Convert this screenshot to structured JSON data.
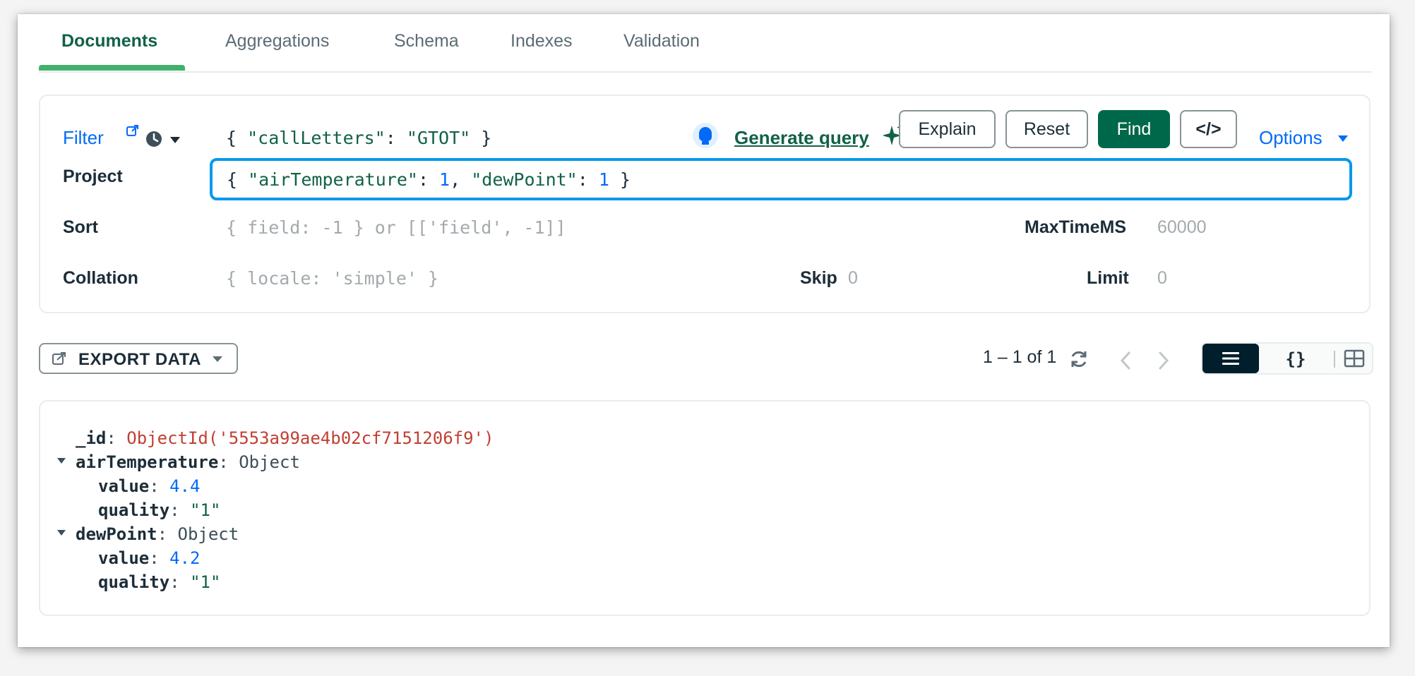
{
  "tabs": [
    {
      "label": "Documents",
      "active": true
    },
    {
      "label": "Aggregations"
    },
    {
      "label": "Schema"
    },
    {
      "label": "Indexes"
    },
    {
      "label": "Validation"
    }
  ],
  "query": {
    "filter_label": "Filter",
    "filter_open": "{ ",
    "filter_key": "\"callLetters\"",
    "filter_colon": ": ",
    "filter_value": "\"GTOT\"",
    "filter_close": " }",
    "generate_query_label": "Generate query",
    "explain_label": "Explain",
    "reset_label": "Reset",
    "find_label": "Find",
    "code_label": "</>",
    "options_label": "Options",
    "project_label": "Project",
    "project_parts": {
      "open": "{ ",
      "k1": "\"airTemperature\"",
      "c1": ": ",
      "v1": "1",
      "sep": ", ",
      "k2": "\"dewPoint\"",
      "c2": ": ",
      "v2": "1",
      "close": " }"
    },
    "sort_label": "Sort",
    "sort_placeholder": "{ field: -1 } or [['field', -1]]",
    "maxtime_label": "MaxTimeMS",
    "maxtime_placeholder": "60000",
    "collation_label": "Collation",
    "collation_placeholder": "{ locale: 'simple' }",
    "skip_label": "Skip",
    "skip_placeholder": "0",
    "limit_label": "Limit",
    "limit_placeholder": "0"
  },
  "toolbar": {
    "export_label": "EXPORT DATA",
    "pagination": "1 – 1 of 1"
  },
  "document": {
    "id_key": "_id",
    "id_value": "ObjectId('5553a99ae4b02cf7151206f9')",
    "air_key": "airTemperature",
    "air_type": "Object",
    "air_value_key": "value",
    "air_value": "4.4",
    "air_quality_key": "quality",
    "air_quality": "\"1\"",
    "dew_key": "dewPoint",
    "dew_type": "Object",
    "dew_value_key": "value",
    "dew_value": "4.2",
    "dew_quality_key": "quality",
    "dew_quality": "\"1\""
  },
  "colors": {
    "accent_green": "#00684a",
    "link_blue": "#016bf8",
    "focus_blue": "#0498ec",
    "objectid_red": "#c13f32"
  },
  "icons": [
    "external-link-icon",
    "history-icon",
    "lightbulb-icon",
    "sparkle-icon",
    "export-icon",
    "refresh-icon",
    "chevron-left-icon",
    "chevron-right-icon",
    "list-view-icon",
    "json-view-icon",
    "table-view-icon"
  ]
}
